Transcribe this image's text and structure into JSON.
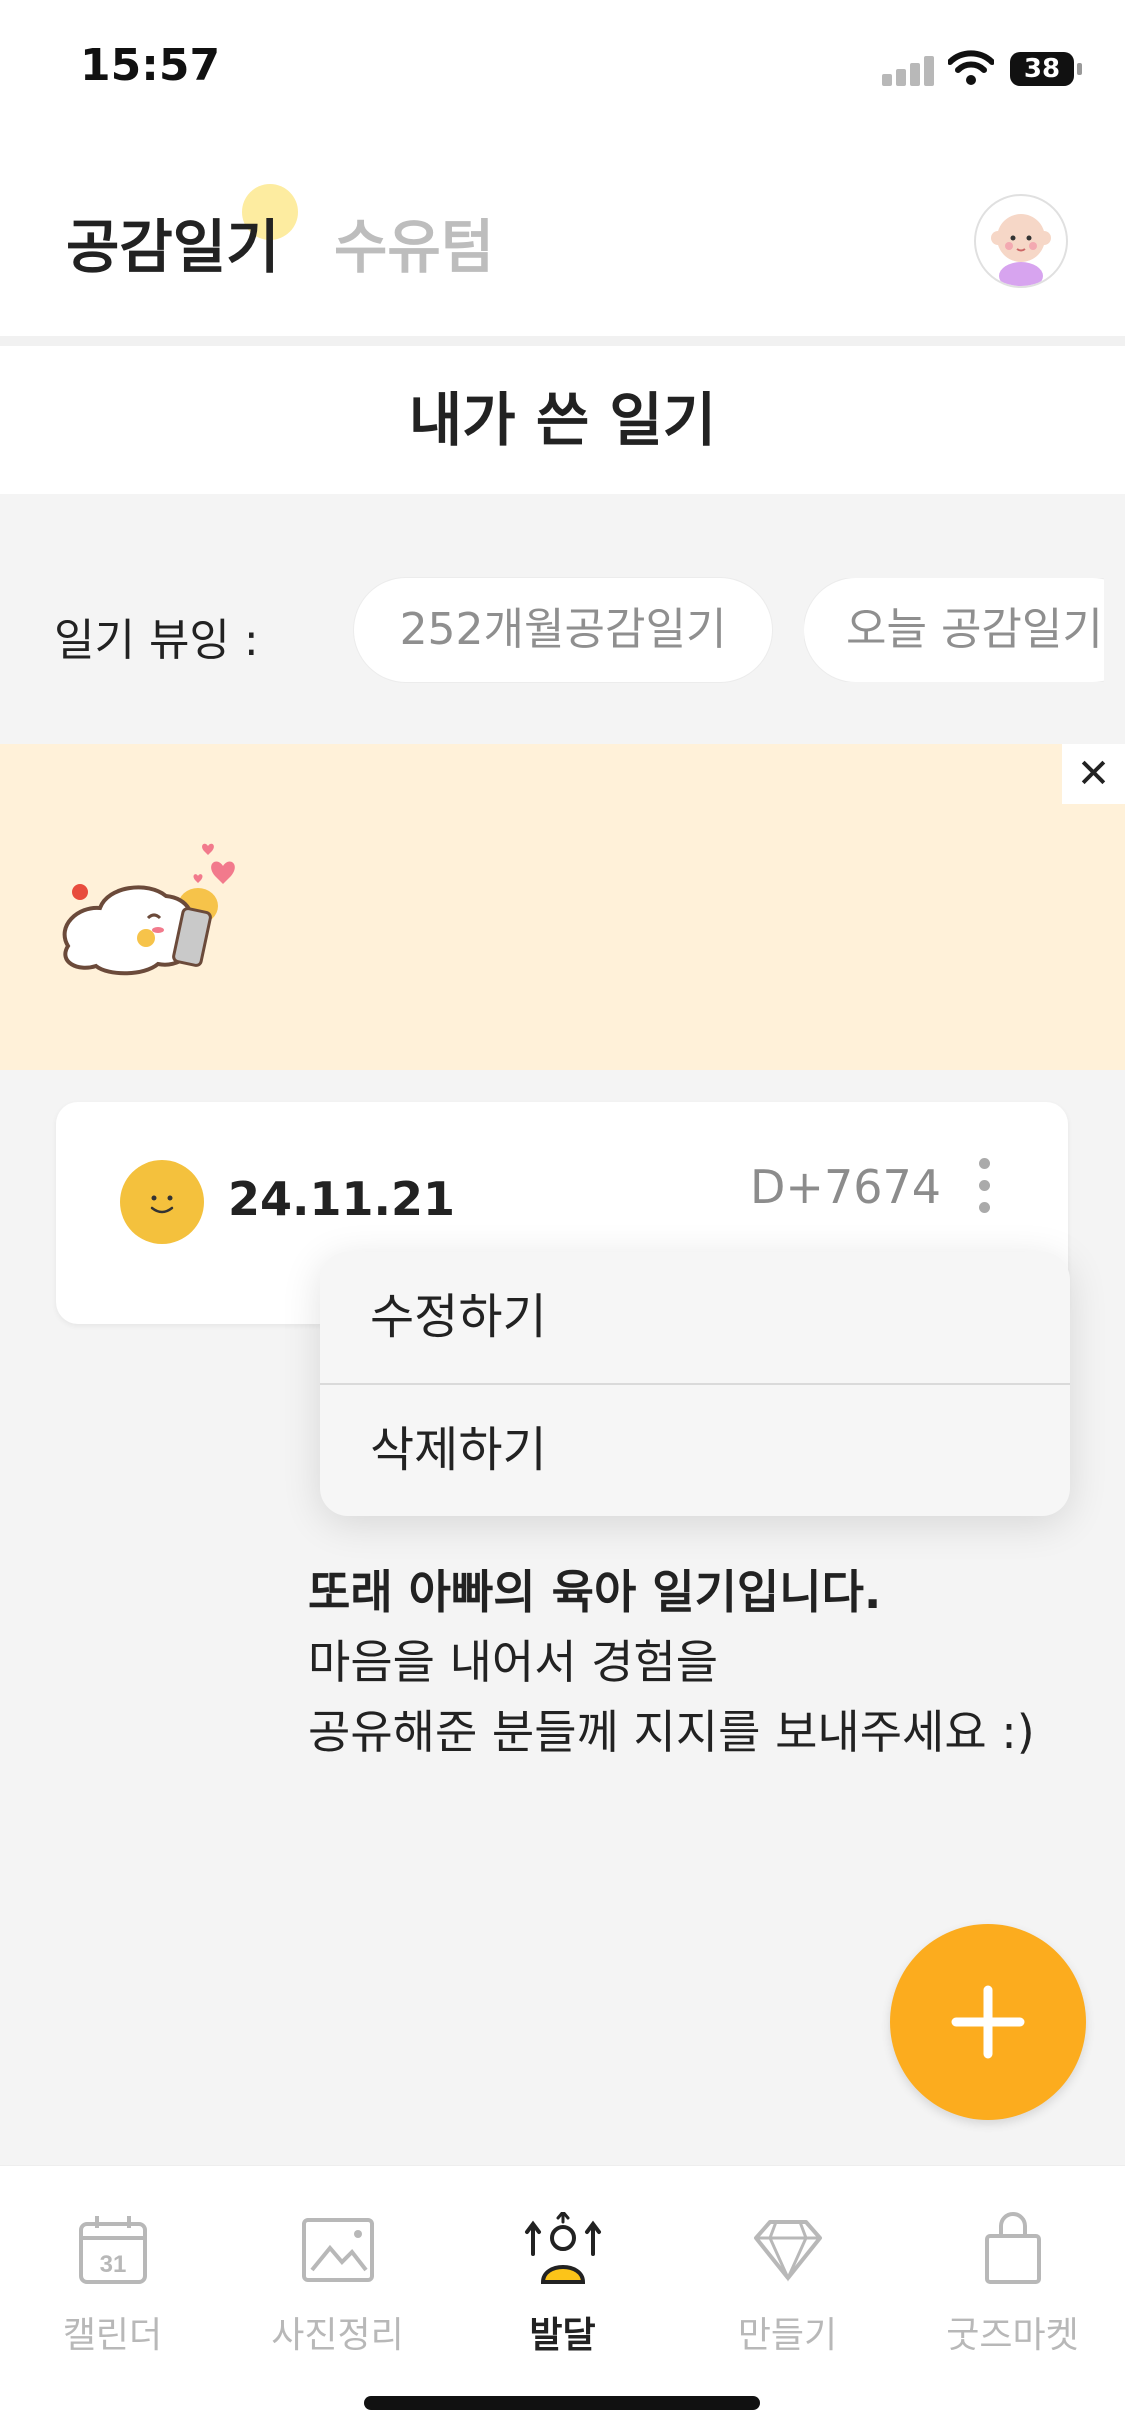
{
  "status_bar": {
    "time": "15:57",
    "battery": "38"
  },
  "header": {
    "tabs": [
      "공감일기",
      "수유텀"
    ],
    "active_tab": 0
  },
  "page_title": "내가 쓴 일기",
  "filter": {
    "label": "일기 뷰잉 :",
    "chips": [
      "252개월공감일기",
      "오늘 공감일기"
    ]
  },
  "banner": {
    "line1": "또래 아빠의 육아 일기입니다.",
    "line2": "마음을 내어서 경험을",
    "line3": "공유해준 분들께 지지를 보내주세요 :)",
    "close": "✕"
  },
  "diary_card": {
    "date": "24.11.21",
    "dday": "D+7674"
  },
  "context_menu": {
    "items": [
      "수정하기",
      "삭제하기"
    ]
  },
  "fab": {
    "icon": "plus-icon"
  },
  "tab_bar": {
    "items": [
      {
        "label": "캘린더",
        "icon": "calendar-icon",
        "calendar_day": "31"
      },
      {
        "label": "사진정리",
        "icon": "photo-icon"
      },
      {
        "label": "발달",
        "icon": "growth-icon"
      },
      {
        "label": "만들기",
        "icon": "diamond-icon"
      },
      {
        "label": "굿즈마켓",
        "icon": "shopping-bag-icon"
      }
    ],
    "active_index": 2
  },
  "colors": {
    "accent": "#fcac1e",
    "banner_bg": "#fff1d9",
    "mood": "#f4c13d",
    "inactive": "#b8b8b8"
  }
}
